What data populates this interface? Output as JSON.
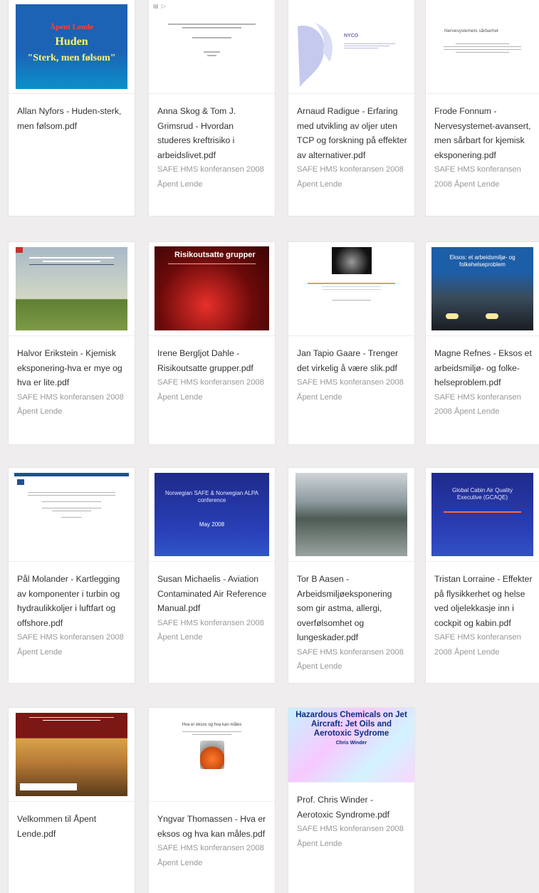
{
  "cards": [
    {
      "title": "Allan Nyfors - Huden-sterk, men følsom.pdf",
      "subtitle": "",
      "slide": {
        "line1": "Åpent Lende",
        "line2": "Huden",
        "line3": "\"Sterk, men følsom\""
      }
    },
    {
      "title": "Anna Skog & Tom J. Grimsrud - Hvordan studeres kreftrisiko i arbeidslivet.pdf",
      "subtitle": "SAFE HMS konferansen 2008 Åpent Lende",
      "slide": {}
    },
    {
      "title": "Arnaud Radigue - Erfaring med utvikling av oljer uten TCP og forskning på effekter av alternativer.pdf",
      "subtitle": "SAFE HMS konferansen 2008 Åpent Lende",
      "slide": {
        "line1": "NYCO"
      }
    },
    {
      "title": "Frode Fonnum - Nervesystemet-avansert, men sårbart for kjemisk eksponering.pdf",
      "subtitle": "SAFE HMS konferansen 2008 Åpent Lende",
      "slide": {
        "line1": "Nervesystemets sårbarhet"
      }
    },
    {
      "title": "Halvor Erikstein - Kjemisk eksponering-hva er mye og hva er lite.pdf",
      "subtitle": "SAFE HMS konferansen 2008 Åpent Lende",
      "slide": {}
    },
    {
      "title": "Irene Bergljot Dahle - Risikoutsatte grupper.pdf",
      "subtitle": "SAFE HMS konferansen 2008 Åpent Lende",
      "slide": {
        "line1": "Risikoutsatte grupper"
      }
    },
    {
      "title": "Jan Tapio Gaare - Trenger det virkelig å være slik.pdf",
      "subtitle": "SAFE HMS konferansen 2008 Åpent Lende",
      "slide": {}
    },
    {
      "title": "Magne Refnes - Eksos et arbeidsmiljø- og folke-helseproblem.pdf",
      "subtitle": "SAFE HMS konferansen 2008 Åpent Lende",
      "slide": {
        "line1": "Eksos: et arbeidsmiljø- og folkehelseproblem"
      }
    },
    {
      "title": "Pål Molander - Kartlegging av komponenter i turbin og hydraulikkoljer i luftfart og offshore.pdf",
      "subtitle": "SAFE HMS konferansen 2008 Åpent Lende",
      "slide": {}
    },
    {
      "title": "Susan Michaelis - Aviation Contaminated Air Reference Manual.pdf",
      "subtitle": "SAFE HMS konferansen 2008 Åpent Lende",
      "slide": {
        "line1": "Norwegian SAFE & Norwegian ALPA conference",
        "line2": "May 2008"
      }
    },
    {
      "title": "Tor B Aasen - Arbeidsmiljøeksponering som gir astma, allergi, overfølsomhet og lungeskader.pdf",
      "subtitle": "SAFE HMS konferansen 2008 Åpent Lende",
      "slide": {}
    },
    {
      "title": "Tristan Lorraine - Effekter på flysikkerhet og helse ved oljelekkasje inn i cockpit og kabin.pdf",
      "subtitle": "SAFE HMS konferansen 2008 Åpent Lende",
      "slide": {
        "line1": "Global Cabin Air Quality Executive (GCAQE)"
      }
    },
    {
      "title": "Velkommen til Åpent Lende.pdf",
      "subtitle": "",
      "slide": {}
    },
    {
      "title": "Yngvar Thomassen - Hva er eksos og hva kan måles.pdf",
      "subtitle": "SAFE HMS konferansen 2008 Åpent Lende",
      "slide": {
        "line1": "Hva er eksos og hva kan måles"
      }
    },
    {
      "title": "Prof. Chris Winder - Aerotoxic Syndrome.pdf",
      "subtitle": "SAFE HMS konferansen 2008 Åpent Lende",
      "slide": {
        "line1": "Hazardous Chemicals on Jet Aircraft: Jet Oils and Aerotoxic Sydrome",
        "line2": "Chris Winder"
      }
    }
  ]
}
